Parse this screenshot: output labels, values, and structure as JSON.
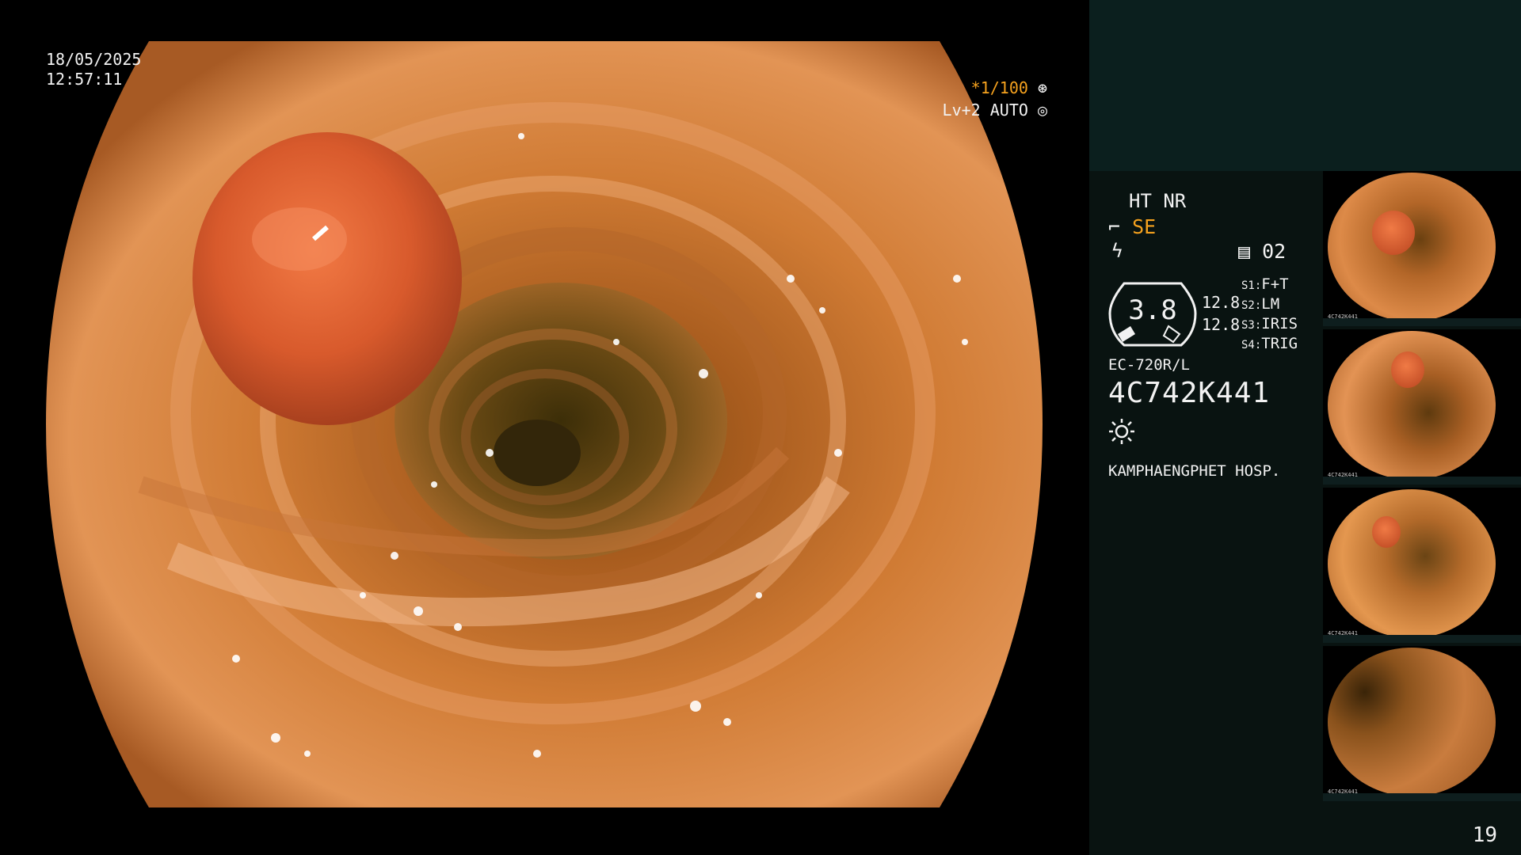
{
  "overlay": {
    "date": "18/05/2025",
    "time": "12:57:11",
    "shutter": "*1/100",
    "level": "Lv+2 AUTO"
  },
  "panel": {
    "ht_nr": "HT NR",
    "mode": "SE",
    "counter": "02",
    "gauge_value": "3.8",
    "val1": "12.8",
    "val2": "12.8",
    "s1_key": "S1:",
    "s1_val": "F+T",
    "s2_key": "S2:",
    "s2_val": "LM",
    "s3_key": "S3:",
    "s3_val": "IRIS",
    "s4_key": "S4:",
    "s4_val": "TRIG",
    "model": "EC-720R/L",
    "serial": "4C742K441",
    "hospital": "KAMPHAENGPHET HOSP."
  },
  "thumbnails": [
    {
      "serial": "4C742K441"
    },
    {
      "serial": "4C742K441"
    },
    {
      "serial": "4C742K441"
    },
    {
      "serial": "4C742K441"
    }
  ],
  "page_number": "19",
  "colors": {
    "accent": "#f6a21e",
    "panel_bg": "#091311",
    "panel_top": "#0b1f1e"
  }
}
